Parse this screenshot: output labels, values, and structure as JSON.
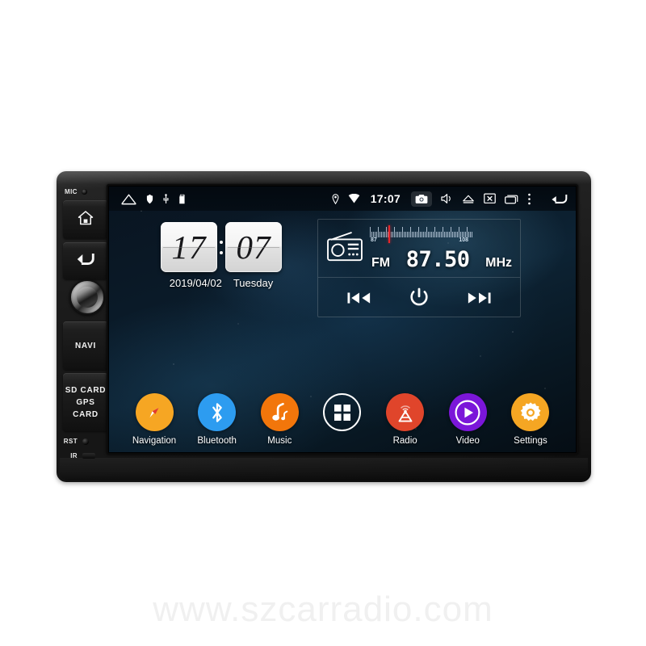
{
  "watermark": {
    "text": "www.szcarradio.com"
  },
  "device": {
    "left_panel": {
      "mic_label": "MIC",
      "home_key_icon": "home-icon",
      "back_key_icon": "back-arrow-icon",
      "volume_knob_icon": "rotary-knob",
      "navi_label": "NAVI",
      "sd_card_label": "SD CARD",
      "gps_card_label": "GPS CARD",
      "rst_label": "RST",
      "ir_label": "IR"
    }
  },
  "screen": {
    "status_bar": {
      "left_icons": [
        "home-icon",
        "shield-icon",
        "usb-icon",
        "sd-card-icon"
      ],
      "location_icon": "location-pin-icon",
      "wifi_icon": "wifi-icon",
      "clock": "17:07",
      "camera_icon": "camera-icon",
      "right_icons": [
        "volume-icon",
        "eject-icon",
        "screen-off-icon",
        "recent-apps-icon",
        "overflow-menu-icon",
        "back-arrow-icon"
      ]
    },
    "clock_widget": {
      "hours": "17",
      "minutes": "07",
      "date": "2019/04/02",
      "weekday": "Tuesday"
    },
    "radio_widget": {
      "icon": "radio-icon",
      "band": "FM",
      "frequency": "87.50",
      "unit": "MHz",
      "scale_min": "87",
      "scale_max": "108",
      "prev_icon": "previous-track-icon",
      "power_icon": "power-icon",
      "next_icon": "next-track-icon"
    },
    "apps": [
      {
        "label": "Navigation",
        "icon": "compass-icon",
        "color": "#F6A623"
      },
      {
        "label": "Bluetooth",
        "icon": "bluetooth-icon",
        "color": "#2D9CF0"
      },
      {
        "label": "Music",
        "icon": "music-note-icon",
        "color": "#F2760B"
      },
      {
        "label": "",
        "icon": "apps-grid-icon",
        "color": "transparent"
      },
      {
        "label": "Radio",
        "icon": "radio-tower-icon",
        "color": "#E0452B"
      },
      {
        "label": "Video",
        "icon": "play-icon",
        "color": "#7B16D9"
      },
      {
        "label": "Settings",
        "icon": "gear-icon",
        "color": "#F5A623"
      }
    ]
  }
}
